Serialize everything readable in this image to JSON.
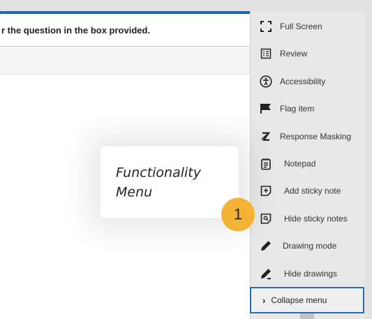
{
  "question": {
    "instruction": "r the question in the box provided."
  },
  "menu": {
    "items": [
      {
        "label": "Full Screen",
        "icon": "fullscreen-icon"
      },
      {
        "label": "Review",
        "icon": "review-icon"
      },
      {
        "label": "Accessibility",
        "icon": "accessibility-icon"
      },
      {
        "label": "Flag item",
        "icon": "flag-icon"
      },
      {
        "label": "Response Masking",
        "icon": "response-masking-icon"
      },
      {
        "label": "Notepad",
        "icon": "notepad-icon"
      },
      {
        "label": "Add sticky note",
        "icon": "add-sticky-note-icon"
      },
      {
        "label": "Hide sticky notes",
        "icon": "hide-sticky-notes-icon"
      },
      {
        "label": "Drawing mode",
        "icon": "pencil-icon"
      },
      {
        "label": "Hide drawings",
        "icon": "hide-drawings-icon"
      }
    ],
    "collapse_label": "Collapse menu"
  },
  "tooltip": {
    "line1": "Functionality",
    "line2": "Menu"
  },
  "badge": {
    "number": "1"
  },
  "colors": {
    "accent": "#1a66b3",
    "badge": "#f5b335",
    "collapse_border": "#2a6ab0"
  }
}
